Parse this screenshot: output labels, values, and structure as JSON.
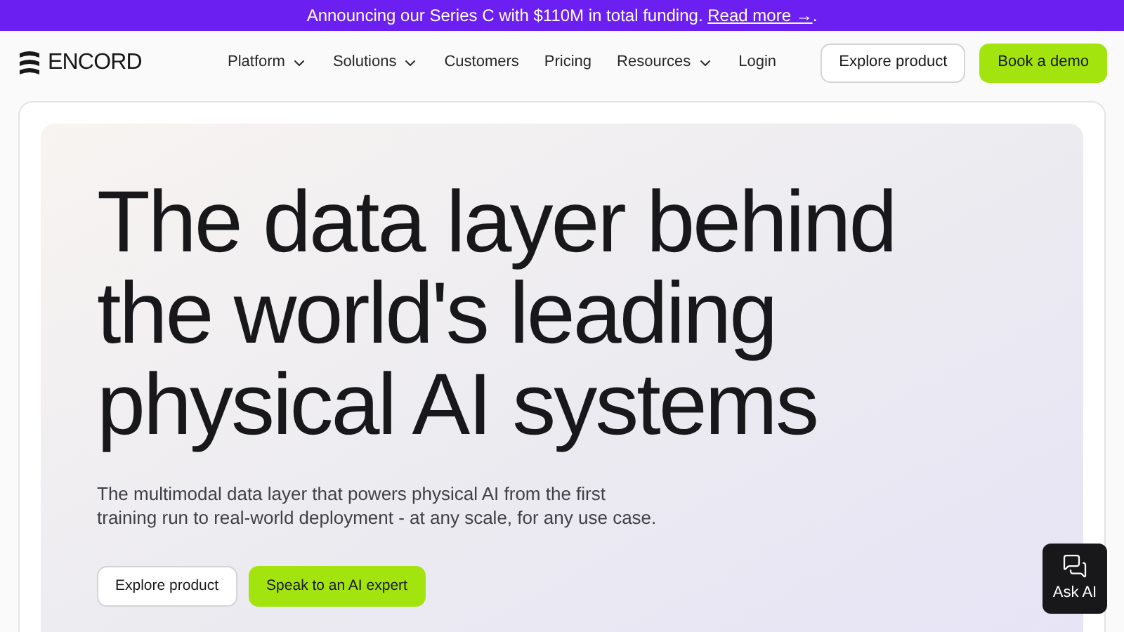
{
  "banner": {
    "text": "Announcing our Series C with $110M in total funding.",
    "link": "Read more →",
    "suffix": "."
  },
  "nav": {
    "logo": "ENCORD",
    "items": [
      {
        "label": "Platform",
        "dropdown": true
      },
      {
        "label": "Solutions",
        "dropdown": true
      },
      {
        "label": "Customers",
        "dropdown": false
      },
      {
        "label": "Pricing",
        "dropdown": false
      },
      {
        "label": "Resources",
        "dropdown": true
      },
      {
        "label": "Login",
        "dropdown": false
      }
    ],
    "buttons": [
      {
        "label": "Explore product",
        "kind": "outline"
      },
      {
        "label": "Book a demo",
        "kind": "primary"
      }
    ]
  },
  "hero": {
    "heading": "The data layer behind the world's leading physical AI systems",
    "subtext": "The multimodal data layer that powers physical AI from the first training run to real-world deployment - at any scale, for any use case.",
    "buttons": [
      {
        "label": "Explore product",
        "kind": "outline"
      },
      {
        "label": "Speak to an AI expert",
        "kind": "primary"
      }
    ]
  },
  "chat": {
    "label": "Ask AI"
  }
}
